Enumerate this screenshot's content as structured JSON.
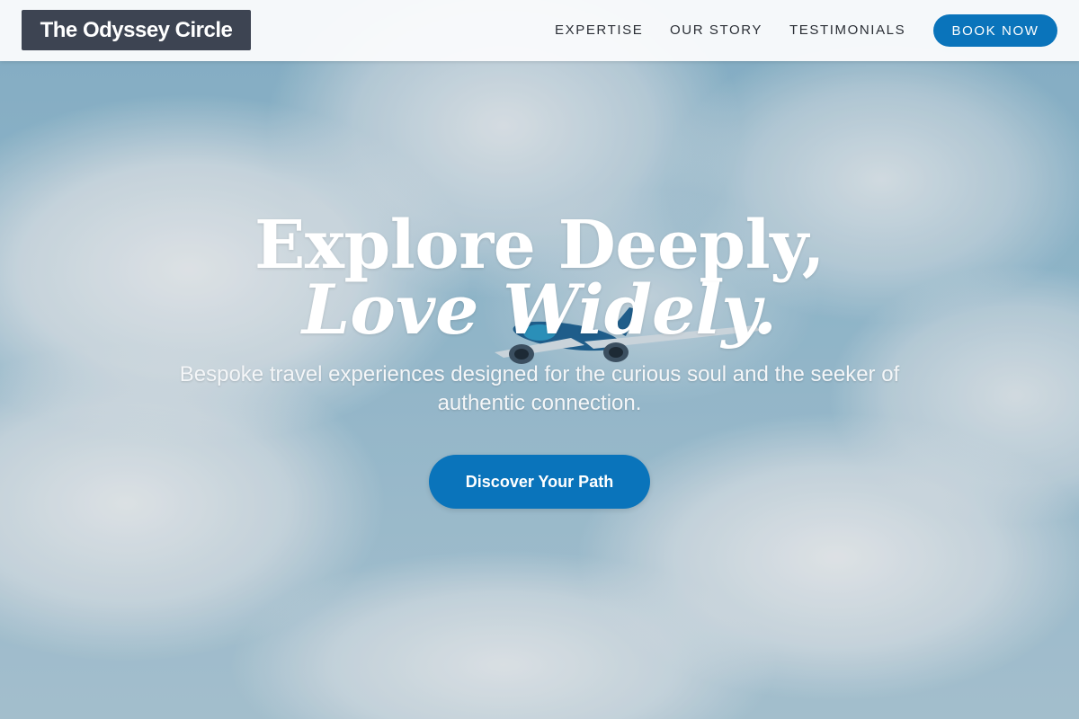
{
  "header": {
    "logo_text": "The Odyssey Circle",
    "nav": [
      {
        "label": "EXPERTISE"
      },
      {
        "label": "OUR STORY"
      },
      {
        "label": "TESTIMONIALS"
      }
    ],
    "cta_label": "BOOK NOW"
  },
  "hero": {
    "headline_line1": "Explore Deeply,",
    "headline_line2": "Love Widely.",
    "subtitle": "Bespoke travel experiences designed for the curious soul and the seeker of authentic connection.",
    "cta_label": "Discover Your Path",
    "background_image": "airplane-in-clouds"
  },
  "colors": {
    "accent": "#0a74bb",
    "logo_bg": "#3d4452",
    "header_bg": "#fafbfc",
    "nav_text": "#2b2f36"
  }
}
